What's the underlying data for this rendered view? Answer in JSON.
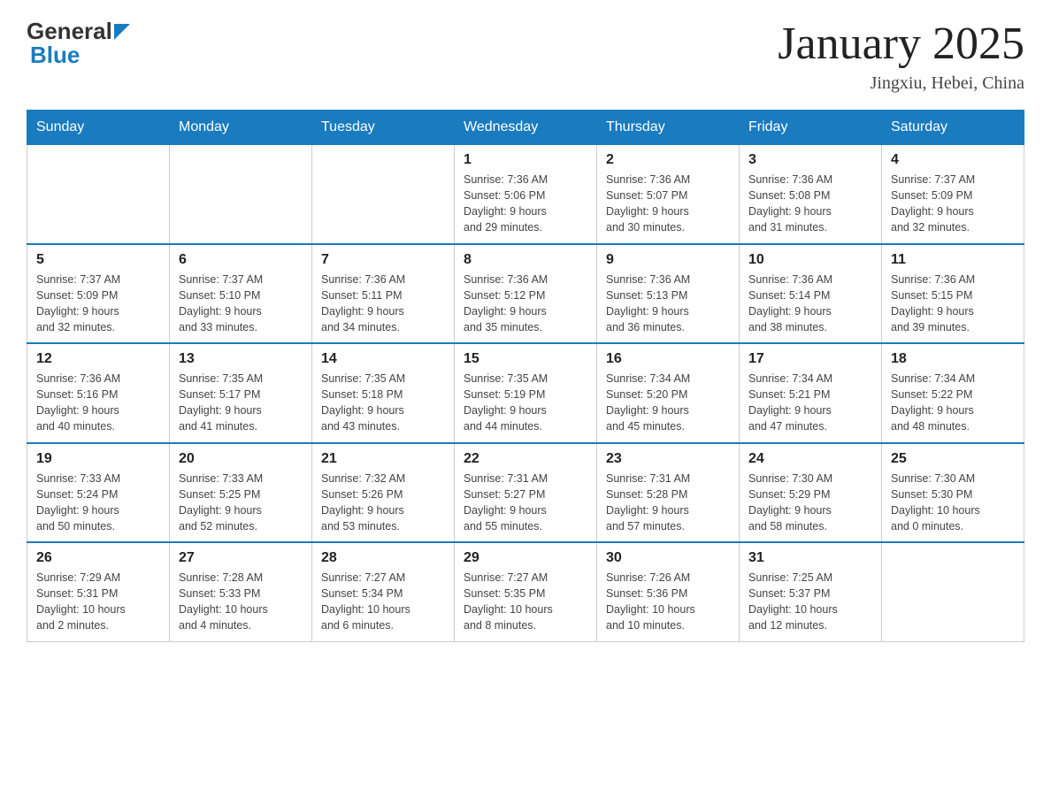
{
  "header": {
    "title": "January 2025",
    "subtitle": "Jingxiu, Hebei, China",
    "logo_general": "General",
    "logo_blue": "Blue"
  },
  "days_of_week": [
    "Sunday",
    "Monday",
    "Tuesday",
    "Wednesday",
    "Thursday",
    "Friday",
    "Saturday"
  ],
  "weeks": [
    [
      {
        "day": "",
        "info": ""
      },
      {
        "day": "",
        "info": ""
      },
      {
        "day": "",
        "info": ""
      },
      {
        "day": "1",
        "info": "Sunrise: 7:36 AM\nSunset: 5:06 PM\nDaylight: 9 hours\nand 29 minutes."
      },
      {
        "day": "2",
        "info": "Sunrise: 7:36 AM\nSunset: 5:07 PM\nDaylight: 9 hours\nand 30 minutes."
      },
      {
        "day": "3",
        "info": "Sunrise: 7:36 AM\nSunset: 5:08 PM\nDaylight: 9 hours\nand 31 minutes."
      },
      {
        "day": "4",
        "info": "Sunrise: 7:37 AM\nSunset: 5:09 PM\nDaylight: 9 hours\nand 32 minutes."
      }
    ],
    [
      {
        "day": "5",
        "info": "Sunrise: 7:37 AM\nSunset: 5:09 PM\nDaylight: 9 hours\nand 32 minutes."
      },
      {
        "day": "6",
        "info": "Sunrise: 7:37 AM\nSunset: 5:10 PM\nDaylight: 9 hours\nand 33 minutes."
      },
      {
        "day": "7",
        "info": "Sunrise: 7:36 AM\nSunset: 5:11 PM\nDaylight: 9 hours\nand 34 minutes."
      },
      {
        "day": "8",
        "info": "Sunrise: 7:36 AM\nSunset: 5:12 PM\nDaylight: 9 hours\nand 35 minutes."
      },
      {
        "day": "9",
        "info": "Sunrise: 7:36 AM\nSunset: 5:13 PM\nDaylight: 9 hours\nand 36 minutes."
      },
      {
        "day": "10",
        "info": "Sunrise: 7:36 AM\nSunset: 5:14 PM\nDaylight: 9 hours\nand 38 minutes."
      },
      {
        "day": "11",
        "info": "Sunrise: 7:36 AM\nSunset: 5:15 PM\nDaylight: 9 hours\nand 39 minutes."
      }
    ],
    [
      {
        "day": "12",
        "info": "Sunrise: 7:36 AM\nSunset: 5:16 PM\nDaylight: 9 hours\nand 40 minutes."
      },
      {
        "day": "13",
        "info": "Sunrise: 7:35 AM\nSunset: 5:17 PM\nDaylight: 9 hours\nand 41 minutes."
      },
      {
        "day": "14",
        "info": "Sunrise: 7:35 AM\nSunset: 5:18 PM\nDaylight: 9 hours\nand 43 minutes."
      },
      {
        "day": "15",
        "info": "Sunrise: 7:35 AM\nSunset: 5:19 PM\nDaylight: 9 hours\nand 44 minutes."
      },
      {
        "day": "16",
        "info": "Sunrise: 7:34 AM\nSunset: 5:20 PM\nDaylight: 9 hours\nand 45 minutes."
      },
      {
        "day": "17",
        "info": "Sunrise: 7:34 AM\nSunset: 5:21 PM\nDaylight: 9 hours\nand 47 minutes."
      },
      {
        "day": "18",
        "info": "Sunrise: 7:34 AM\nSunset: 5:22 PM\nDaylight: 9 hours\nand 48 minutes."
      }
    ],
    [
      {
        "day": "19",
        "info": "Sunrise: 7:33 AM\nSunset: 5:24 PM\nDaylight: 9 hours\nand 50 minutes."
      },
      {
        "day": "20",
        "info": "Sunrise: 7:33 AM\nSunset: 5:25 PM\nDaylight: 9 hours\nand 52 minutes."
      },
      {
        "day": "21",
        "info": "Sunrise: 7:32 AM\nSunset: 5:26 PM\nDaylight: 9 hours\nand 53 minutes."
      },
      {
        "day": "22",
        "info": "Sunrise: 7:31 AM\nSunset: 5:27 PM\nDaylight: 9 hours\nand 55 minutes."
      },
      {
        "day": "23",
        "info": "Sunrise: 7:31 AM\nSunset: 5:28 PM\nDaylight: 9 hours\nand 57 minutes."
      },
      {
        "day": "24",
        "info": "Sunrise: 7:30 AM\nSunset: 5:29 PM\nDaylight: 9 hours\nand 58 minutes."
      },
      {
        "day": "25",
        "info": "Sunrise: 7:30 AM\nSunset: 5:30 PM\nDaylight: 10 hours\nand 0 minutes."
      }
    ],
    [
      {
        "day": "26",
        "info": "Sunrise: 7:29 AM\nSunset: 5:31 PM\nDaylight: 10 hours\nand 2 minutes."
      },
      {
        "day": "27",
        "info": "Sunrise: 7:28 AM\nSunset: 5:33 PM\nDaylight: 10 hours\nand 4 minutes."
      },
      {
        "day": "28",
        "info": "Sunrise: 7:27 AM\nSunset: 5:34 PM\nDaylight: 10 hours\nand 6 minutes."
      },
      {
        "day": "29",
        "info": "Sunrise: 7:27 AM\nSunset: 5:35 PM\nDaylight: 10 hours\nand 8 minutes."
      },
      {
        "day": "30",
        "info": "Sunrise: 7:26 AM\nSunset: 5:36 PM\nDaylight: 10 hours\nand 10 minutes."
      },
      {
        "day": "31",
        "info": "Sunrise: 7:25 AM\nSunset: 5:37 PM\nDaylight: 10 hours\nand 12 minutes."
      },
      {
        "day": "",
        "info": ""
      }
    ]
  ]
}
